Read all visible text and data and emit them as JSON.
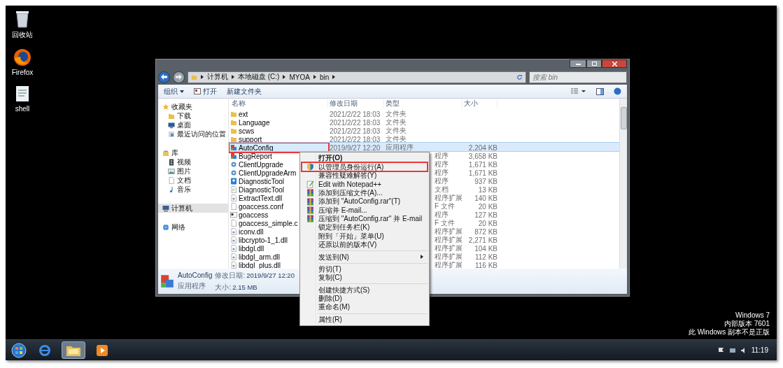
{
  "desktop": {
    "icons": [
      {
        "label": "回收站",
        "kind": "recycle"
      },
      {
        "label": "Firefox",
        "kind": "browser"
      },
      {
        "label": "shell",
        "kind": "document"
      }
    ],
    "os_notice": [
      "Windows 7",
      "内部版本 7601",
      "此 Windows 副本不是正版"
    ]
  },
  "explorer": {
    "breadcrumb": [
      "计算机",
      "本地磁盘 (C:)",
      "MYOA",
      "bin"
    ],
    "search": {
      "placeholder": "搜索 bin"
    },
    "toolbar": [
      {
        "label": "组织",
        "kind": "menu"
      },
      {
        "label": "打开",
        "kind": "open"
      },
      {
        "label": "新建文件夹",
        "kind": "plain"
      }
    ],
    "nav": [
      {
        "label": "收藏夹",
        "kind": "star",
        "selected": false,
        "children": [
          {
            "label": "下载",
            "kind": "folder",
            "selected": false
          },
          {
            "label": "桌面",
            "kind": "monitor",
            "selected": false
          },
          {
            "label": "最近访问的位置",
            "kind": "recent",
            "selected": false
          }
        ]
      },
      {
        "label": "库",
        "kind": "library",
        "selected": false,
        "children": [
          {
            "label": "视频",
            "kind": "film",
            "selected": false
          },
          {
            "label": "图片",
            "kind": "image",
            "selected": false
          },
          {
            "label": "文档",
            "kind": "doc",
            "selected": false
          },
          {
            "label": "音乐",
            "kind": "music",
            "selected": false
          }
        ]
      },
      {
        "label": "计算机",
        "kind": "computer",
        "selected": true
      },
      {
        "label": "网络",
        "kind": "network",
        "selected": false
      }
    ],
    "columns": [
      "名称",
      "修改日期",
      "类型",
      "大小"
    ],
    "files": [
      {
        "name": "ext",
        "kind": "folder",
        "date": "2021/2/22 18:03",
        "type": "文件夹",
        "selected": false,
        "highlighted": false
      },
      {
        "name": "Language",
        "kind": "folder",
        "date": "2021/2/22 18:03",
        "type": "文件夹",
        "selected": false,
        "highlighted": false
      },
      {
        "name": "scws",
        "kind": "folder",
        "date": "2021/2/22 18:03",
        "type": "文件夹",
        "selected": false,
        "highlighted": false
      },
      {
        "name": "support",
        "kind": "folder",
        "date": "2021/2/22 18:03",
        "type": "文件夹",
        "selected": false,
        "highlighted": false
      },
      {
        "name": "AutoConfig",
        "kind": "app",
        "date": "2019/9/27 12:20",
        "type": "应用程序",
        "size": "2,204 KB",
        "selected": true,
        "highlighted": true
      },
      {
        "name": "BugReport",
        "kind": "app",
        "type": "程序",
        "size": "3,658 KB",
        "selected": false,
        "highlighted": false
      },
      {
        "name": "ClientUpgrade",
        "kind": "setup",
        "type": "程序",
        "size": "1,671 KB",
        "selected": false,
        "highlighted": false
      },
      {
        "name": "ClientUpgradeArm",
        "kind": "setup",
        "type": "程序",
        "size": "1,671 KB",
        "selected": false,
        "highlighted": false
      },
      {
        "name": "DiagnosticTool",
        "kind": "tool",
        "type": "程序",
        "size": "937 KB",
        "selected": false,
        "highlighted": false
      },
      {
        "name": "DiagnosticTool",
        "kind": "doc",
        "type": "文档",
        "size": "13 KB",
        "selected": false,
        "highlighted": false
      },
      {
        "name": "ExtractText.dll",
        "kind": "dll",
        "type": "程序扩展",
        "size": "140 KB",
        "selected": false,
        "highlighted": false
      },
      {
        "name": "goaccess.conf",
        "kind": "file",
        "type": "F 文件",
        "size": "20 KB",
        "selected": false,
        "highlighted": false
      },
      {
        "name": "goaccess",
        "kind": "console",
        "type": "程序",
        "size": "127 KB",
        "selected": false,
        "highlighted": false
      },
      {
        "name": "goaccess_simple.c",
        "kind": "file",
        "type": "F 文件",
        "size": "20 KB",
        "selected": false,
        "highlighted": false
      },
      {
        "name": "iconv.dll",
        "kind": "dll",
        "type": "程序扩展",
        "size": "872 KB",
        "selected": false,
        "highlighted": false
      },
      {
        "name": "libcrypto-1_1.dll",
        "kind": "dll",
        "type": "程序扩展",
        "size": "2,271 KB",
        "selected": false,
        "highlighted": false
      },
      {
        "name": "libdgl.dll",
        "kind": "dll",
        "type": "程序扩展",
        "size": "104 KB",
        "selected": false,
        "highlighted": false
      },
      {
        "name": "libdgl_arm.dll",
        "kind": "dll",
        "type": "程序扩展",
        "size": "112 KB",
        "selected": false,
        "highlighted": false
      },
      {
        "name": "libdgl_plus.dll",
        "kind": "dll",
        "type": "程序扩展",
        "size": "116 KB",
        "selected": false,
        "highlighted": false
      }
    ],
    "details": {
      "name": "AutoConfig",
      "type": "应用程序",
      "date_label": "修改日期:",
      "date": "2019/9/27 12:20",
      "size_label": "大小:",
      "size": "2.15 MB"
    }
  },
  "context_menu": [
    {
      "kind": "default",
      "label": "打开(O)",
      "highlighted": false
    },
    {
      "kind": "shield",
      "label": "以管理员身份运行(A)",
      "highlighted": true
    },
    {
      "kind": "plain",
      "label": "兼容性疑难解答(Y)",
      "highlighted": false
    },
    {
      "kind": "notepad",
      "label": "Edit with Notepad++",
      "highlighted": false
    },
    {
      "kind": "archive",
      "label": "添加到压缩文件(A)...",
      "highlighted": false
    },
    {
      "kind": "archive",
      "label": "添加到 \"AutoConfig.rar\"(T)",
      "highlighted": false
    },
    {
      "kind": "archive",
      "label": "压缩并 E-mail...",
      "highlighted": false
    },
    {
      "kind": "archive",
      "label": "压缩到 \"AutoConfig.rar\" 并 E-mail",
      "highlighted": false
    },
    {
      "kind": "plain",
      "label": "锁定到任务栏(K)",
      "highlighted": false
    },
    {
      "kind": "plain",
      "label": "附到「开始」菜单(U)",
      "highlighted": false
    },
    {
      "kind": "plain",
      "label": "还原以前的版本(V)",
      "highlighted": false
    },
    {
      "kind": "separator"
    },
    {
      "kind": "submenu",
      "label": "发送到(N)",
      "highlighted": false
    },
    {
      "kind": "separator"
    },
    {
      "kind": "plain",
      "label": "剪切(T)",
      "highlighted": false
    },
    {
      "kind": "plain",
      "label": "复制(C)",
      "highlighted": false
    },
    {
      "kind": "separator"
    },
    {
      "kind": "plain",
      "label": "创建快捷方式(S)",
      "highlighted": false
    },
    {
      "kind": "plain",
      "label": "删除(D)",
      "highlighted": false
    },
    {
      "kind": "plain",
      "label": "重命名(M)",
      "highlighted": false
    },
    {
      "kind": "separator"
    },
    {
      "kind": "plain",
      "label": "属性(R)",
      "highlighted": false
    }
  ],
  "taskbar": {
    "apps": [
      {
        "kind": "ie",
        "active": false
      },
      {
        "kind": "explorer",
        "active": true
      },
      {
        "kind": "media",
        "active": false
      }
    ],
    "clock": "11:19"
  }
}
